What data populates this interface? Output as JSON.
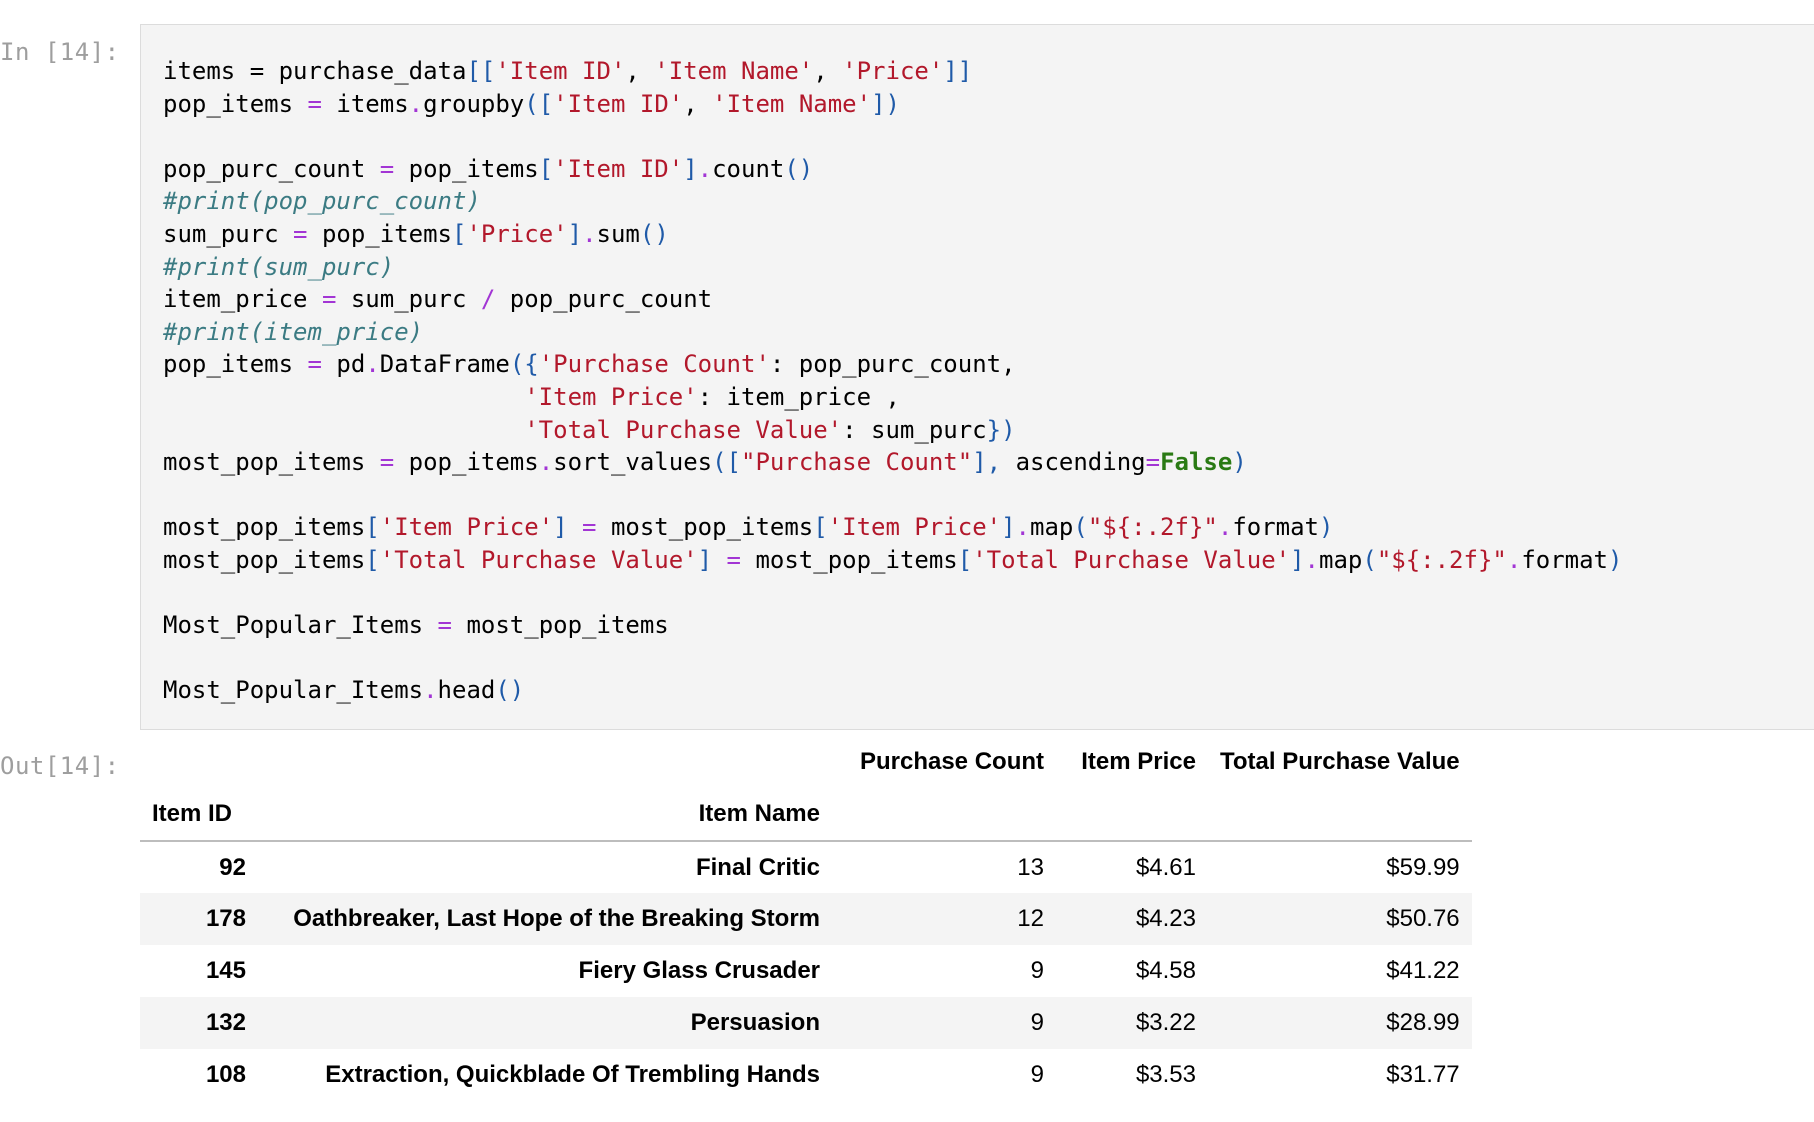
{
  "cell": {
    "in_prompt": "In [14]:",
    "out_prompt": "Out[14]:"
  },
  "code_lines": [
    [
      [
        "items = purchase_data",
        "n"
      ],
      [
        "[[",
        "br"
      ],
      [
        "'Item ID'",
        "str"
      ],
      [
        ", ",
        "n"
      ],
      [
        "'Item Name'",
        "str"
      ],
      [
        ", ",
        "n"
      ],
      [
        "'Price'",
        "str"
      ],
      [
        "]]",
        "br"
      ]
    ],
    [
      [
        "pop_items ",
        "n"
      ],
      [
        "=",
        "op"
      ],
      [
        " items",
        "n"
      ],
      [
        ".",
        "op"
      ],
      [
        "groupby",
        "n"
      ],
      [
        "([",
        "br"
      ],
      [
        "'Item ID'",
        "str"
      ],
      [
        ", ",
        "n"
      ],
      [
        "'Item Name'",
        "str"
      ],
      [
        "])",
        "br"
      ]
    ],
    [],
    [
      [
        "pop_purc_count ",
        "n"
      ],
      [
        "=",
        "op"
      ],
      [
        " pop_items",
        "n"
      ],
      [
        "[",
        "br"
      ],
      [
        "'Item ID'",
        "str"
      ],
      [
        "]",
        "br"
      ],
      [
        ".",
        "op"
      ],
      [
        "count",
        "n"
      ],
      [
        "()",
        "br"
      ]
    ],
    [
      [
        "#print(pop_purc_count)",
        "com"
      ]
    ],
    [
      [
        "sum_purc ",
        "n"
      ],
      [
        "=",
        "op"
      ],
      [
        " pop_items",
        "n"
      ],
      [
        "[",
        "br"
      ],
      [
        "'Price'",
        "str"
      ],
      [
        "]",
        "br"
      ],
      [
        ".",
        "op"
      ],
      [
        "sum",
        "n"
      ],
      [
        "()",
        "br"
      ]
    ],
    [
      [
        "#print(sum_purc)",
        "com"
      ]
    ],
    [
      [
        "item_price ",
        "n"
      ],
      [
        "=",
        "op"
      ],
      [
        " sum_purc ",
        "n"
      ],
      [
        "/",
        "op"
      ],
      [
        " pop_purc_count",
        "n"
      ]
    ],
    [
      [
        "#print(item_price)",
        "com"
      ]
    ],
    [
      [
        "pop_items ",
        "n"
      ],
      [
        "=",
        "op"
      ],
      [
        " pd",
        "n"
      ],
      [
        ".",
        "op"
      ],
      [
        "DataFrame",
        "n"
      ],
      [
        "({",
        "br"
      ],
      [
        "'Purchase Count'",
        "str"
      ],
      [
        ": pop_purc_count,",
        "n"
      ]
    ],
    [
      [
        "                         ",
        "n"
      ],
      [
        "'Item Price'",
        "str"
      ],
      [
        ": item_price ,",
        "n"
      ]
    ],
    [
      [
        "                         ",
        "n"
      ],
      [
        "'Total Purchase Value'",
        "str"
      ],
      [
        ": sum_purc",
        "n"
      ],
      [
        "})",
        "br"
      ]
    ],
    [
      [
        "most_pop_items ",
        "n"
      ],
      [
        "=",
        "op"
      ],
      [
        " pop_items",
        "n"
      ],
      [
        ".",
        "op"
      ],
      [
        "sort_values",
        "n"
      ],
      [
        "([",
        "br"
      ],
      [
        "\"Purchase Count\"",
        "str"
      ],
      [
        "], ",
        "br"
      ],
      [
        "ascending",
        "n"
      ],
      [
        "=",
        "op"
      ],
      [
        "False",
        "kw"
      ],
      [
        ")",
        "br"
      ]
    ],
    [],
    [
      [
        "most_pop_items",
        "n"
      ],
      [
        "[",
        "br"
      ],
      [
        "'Item Price'",
        "str"
      ],
      [
        "]",
        "br"
      ],
      [
        " ",
        "n"
      ],
      [
        "=",
        "op"
      ],
      [
        " most_pop_items",
        "n"
      ],
      [
        "[",
        "br"
      ],
      [
        "'Item Price'",
        "str"
      ],
      [
        "]",
        "br"
      ],
      [
        ".",
        "op"
      ],
      [
        "map",
        "n"
      ],
      [
        "(",
        "br"
      ],
      [
        "\"${:.2f}\"",
        "str"
      ],
      [
        ".",
        "op"
      ],
      [
        "format",
        "n"
      ],
      [
        ")",
        "br"
      ]
    ],
    [
      [
        "most_pop_items",
        "n"
      ],
      [
        "[",
        "br"
      ],
      [
        "'Total Purchase Value'",
        "str"
      ],
      [
        "]",
        "br"
      ],
      [
        " ",
        "n"
      ],
      [
        "=",
        "op"
      ],
      [
        " most_pop_items",
        "n"
      ],
      [
        "[",
        "br"
      ],
      [
        "'Total Purchase Value'",
        "str"
      ],
      [
        "]",
        "br"
      ],
      [
        ".",
        "op"
      ],
      [
        "map",
        "n"
      ],
      [
        "(",
        "br"
      ],
      [
        "\"${:.2f}\"",
        "str"
      ],
      [
        ".",
        "op"
      ],
      [
        "format",
        "n"
      ],
      [
        ")",
        "br"
      ]
    ],
    [],
    [
      [
        "Most_Popular_Items ",
        "n"
      ],
      [
        "=",
        "op"
      ],
      [
        " most_pop_items",
        "n"
      ]
    ],
    [],
    [
      [
        "Most_Popular_Items",
        "n"
      ],
      [
        ".",
        "op"
      ],
      [
        "head",
        "n"
      ],
      [
        "()",
        "br"
      ]
    ]
  ],
  "output": {
    "columns": [
      "Purchase Count",
      "Item Price",
      "Total Purchase Value"
    ],
    "index_names": [
      "Item ID",
      "Item Name"
    ],
    "rows": [
      {
        "item_id": "92",
        "item_name": "Final Critic",
        "purchase_count": "13",
        "item_price": "$4.61",
        "total_value": "$59.99"
      },
      {
        "item_id": "178",
        "item_name": "Oathbreaker, Last Hope of the Breaking Storm",
        "purchase_count": "12",
        "item_price": "$4.23",
        "total_value": "$50.76"
      },
      {
        "item_id": "145",
        "item_name": "Fiery Glass Crusader",
        "purchase_count": "9",
        "item_price": "$4.58",
        "total_value": "$41.22"
      },
      {
        "item_id": "132",
        "item_name": "Persuasion",
        "purchase_count": "9",
        "item_price": "$3.22",
        "total_value": "$28.99"
      },
      {
        "item_id": "108",
        "item_name": "Extraction, Quickblade Of Trembling Hands",
        "purchase_count": "9",
        "item_price": "$3.53",
        "total_value": "$31.77"
      }
    ]
  }
}
